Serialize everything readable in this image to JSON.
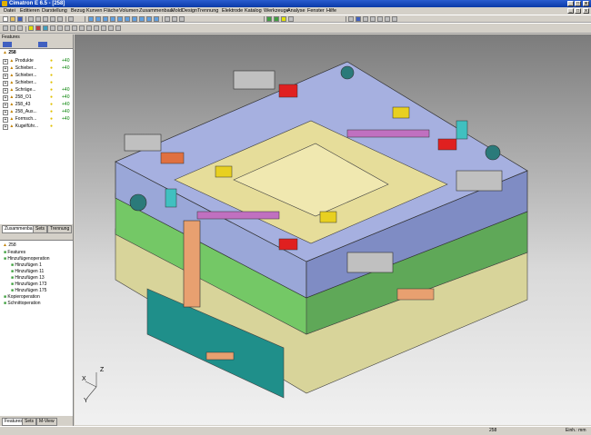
{
  "window": {
    "title": "Cimatron E 6.5 - [258]"
  },
  "menu": [
    "Datei",
    "Editieren",
    "Darstellung",
    "Bezug",
    "Kurven",
    "Fläche",
    "Volumen",
    "Zusammenbau",
    "MoldDesign",
    "Trennung",
    "Elektrode",
    "Katalog",
    "Werkzeuge",
    "Analyse",
    "Fenster",
    "Hilfe"
  ],
  "features_panel": {
    "title": "Features",
    "root": "258",
    "items": [
      {
        "label": "Produkte",
        "flag": "+40"
      },
      {
        "label": "Schieber...",
        "flag": "+40"
      },
      {
        "label": "Schieber...",
        "flag": ""
      },
      {
        "label": "Schieber...",
        "flag": ""
      },
      {
        "label": "Schräge...",
        "flag": "+40"
      },
      {
        "label": "258_O1",
        "flag": "+40"
      },
      {
        "label": "258_43",
        "flag": "+40"
      },
      {
        "label": "258_Aus...",
        "flag": "+40"
      },
      {
        "label": "Formsch...",
        "flag": "+40"
      },
      {
        "label": "Kugelführ...",
        "flag": ""
      }
    ],
    "tabs": [
      "Zusammenbau",
      "Sets",
      "Trennung"
    ]
  },
  "tree_panel": {
    "root": "258",
    "items": [
      "Features",
      "Hinzufügenoperation",
      "Hinzufügen 1",
      "Hinzufügen 11",
      "Hinzufügen 13",
      "Hinzufügen 173",
      "Hinzufügen 175",
      "Kopieroperation",
      "Schnittoperation"
    ],
    "tabs": [
      "Features",
      "Sets",
      "M-View"
    ]
  },
  "axes": {
    "x": "X",
    "y": "Y",
    "z": "Z"
  },
  "status": {
    "center": "258",
    "units": "Einh.: mm"
  }
}
